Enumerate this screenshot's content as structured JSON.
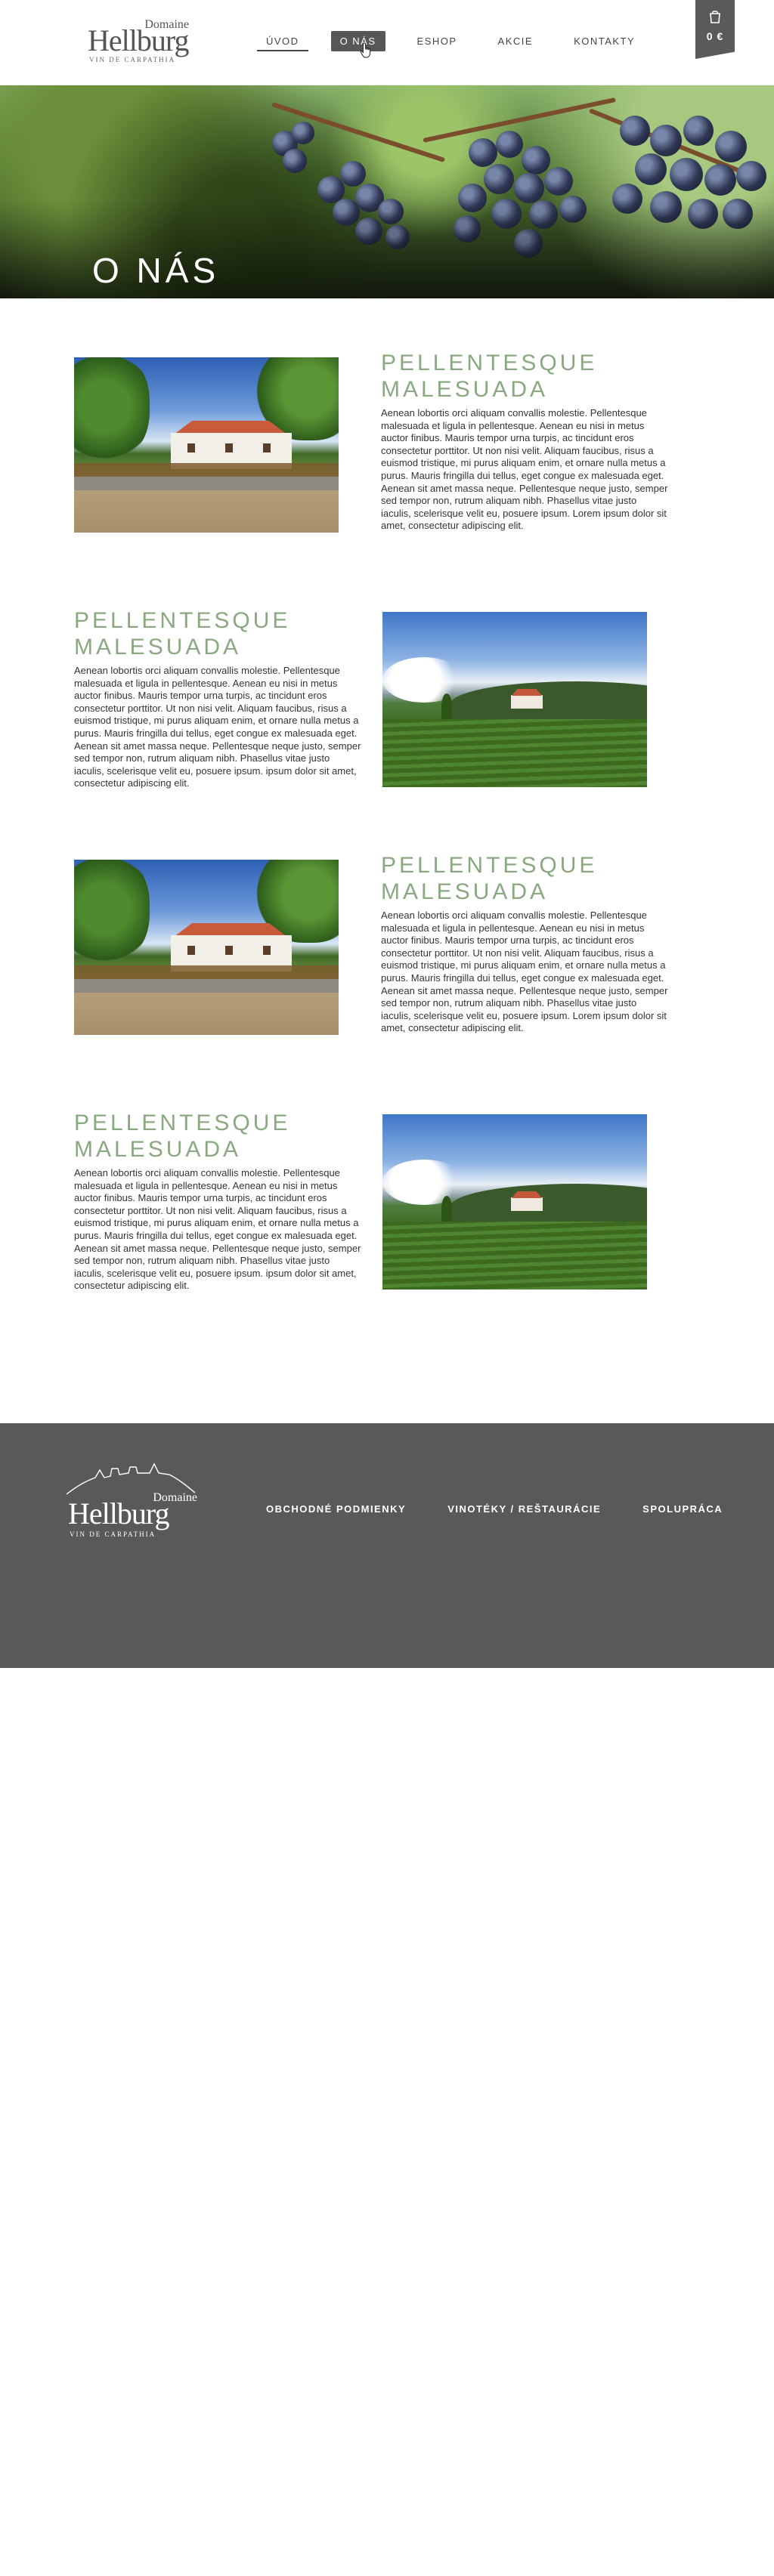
{
  "brand": {
    "domaine": "Domaine",
    "name": "Hellburg",
    "tagline": "VIN DE CARPATHIA"
  },
  "nav": {
    "items": [
      {
        "label": "ÚVOD",
        "state": "active"
      },
      {
        "label": "O NÁS",
        "state": "hover"
      },
      {
        "label": "ESHOP",
        "state": "default"
      },
      {
        "label": "AKCIE",
        "state": "default"
      },
      {
        "label": "KONTAKTY",
        "state": "default"
      }
    ]
  },
  "cart": {
    "icon": "shopping-bag-icon",
    "amount": "0 €"
  },
  "hero": {
    "title": "O NÁS",
    "image": "grape-clusters-photo"
  },
  "sections": [
    {
      "heading": "PELLENTESQUE MALESUADA",
      "text": "Aenean lobortis orci aliquam convallis molestie. Pellentesque malesuada et ligula in pellentesque. Aenean eu nisi in metus auctor finibus. Mauris tempor urna turpis, ac tincidunt eros consectetur porttitor. Ut non nisi velit. Aliquam faucibus, risus a euismod tristique, mi purus aliquam enim, et ornare nulla metus a purus. Mauris fringilla dui tellus, eget congue ex malesuada eget. Aenean sit amet massa neque. Pellentesque neque justo, semper sed tempor non, rutrum aliquam nibh. Phasellus vitae justo iaculis, scelerisque velit eu, posuere ipsum. Lorem ipsum dolor sit amet, consectetur adipiscing elit.",
      "image": "winery-house-photo"
    },
    {
      "heading": "PELLENTESQUE MALESUADA",
      "text": "Aenean lobortis orci aliquam convallis molestie. Pellentesque malesuada et ligula in pellentesque. Aenean eu nisi in metus auctor finibus. Mauris tempor urna turpis, ac tincidunt eros consectetur porttitor. Ut non nisi velit. Aliquam faucibus, risus a euismod tristique, mi purus aliquam enim, et ornare nulla metus a purus. Mauris fringilla dui tellus, eget congue ex malesuada eget. Aenean sit amet massa neque. Pellentesque neque justo, semper sed tempor non, rutrum aliquam nibh. Phasellus vitae justo iaculis, scelerisque velit eu, posuere ipsum. ipsum dolor sit amet, consectetur adipiscing elit.",
      "image": "vineyard-photo"
    },
    {
      "heading": "PELLENTESQUE MALESUADA",
      "text": "Aenean lobortis orci aliquam convallis molestie. Pellentesque malesuada et ligula in pellentesque. Aenean eu nisi in metus auctor finibus. Mauris tempor urna turpis, ac tincidunt eros consectetur porttitor. Ut non nisi velit. Aliquam faucibus, risus a euismod tristique, mi purus aliquam enim, et ornare nulla metus a purus. Mauris fringilla dui tellus, eget congue ex malesuada eget. Aenean sit amet massa neque. Pellentesque neque justo, semper sed tempor non, rutrum aliquam nibh. Phasellus vitae justo iaculis, scelerisque velit eu, posuere ipsum. Lorem ipsum dolor sit amet, consectetur adipiscing elit.",
      "image": "winery-house-photo"
    },
    {
      "heading": "PELLENTESQUE MALESUADA",
      "text": "Aenean lobortis orci aliquam convallis molestie. Pellentesque malesuada et ligula in pellentesque. Aenean eu nisi in metus auctor finibus. Mauris tempor urna turpis, ac tincidunt eros consectetur porttitor. Ut non nisi velit. Aliquam faucibus, risus a euismod tristique, mi purus aliquam enim, et ornare nulla metus a purus. Mauris fringilla dui tellus, eget congue ex malesuada eget. Aenean sit amet massa neque. Pellentesque neque justo, semper sed tempor non, rutrum aliquam nibh. Phasellus vitae justo iaculis, scelerisque velit eu, posuere ipsum. ipsum dolor sit amet, consectetur adipiscing elit.",
      "image": "vineyard-photo"
    }
  ],
  "footer": {
    "links": [
      "OBCHODNÉ PODMIENKY",
      "VINOTÉKY / REŠTAURÁCIE",
      "SPOLUPRÁCA"
    ]
  },
  "colors": {
    "accent_green": "#8aa882",
    "dark_gray": "#58595b",
    "text": "#333333"
  }
}
